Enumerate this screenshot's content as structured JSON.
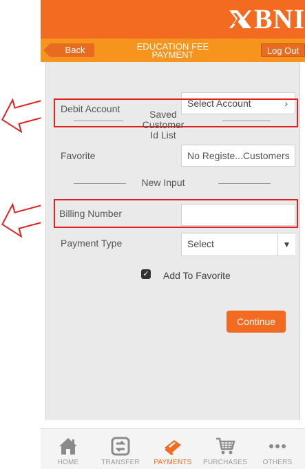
{
  "brand": {
    "logo_text": "BNI",
    "color_primary": "#f26b21",
    "color_secondary": "#f7941e",
    "highlight_color": "#e02020"
  },
  "header": {
    "back_label": "Back",
    "title_line1": "EDUCATION FEE",
    "title_line2": "PAYMENT",
    "logout_label": "Log Out"
  },
  "form": {
    "debit_account_label": "Debit Account",
    "debit_account_value": "Select Account",
    "saved_list_title_line1": "Saved Customer",
    "saved_list_title_line2": "Id List",
    "favorite_label": "Favorite",
    "favorite_value": "No Registe...Customers",
    "new_input_title": "New Input",
    "billing_number_label": "Billing Number",
    "billing_number_value": "",
    "payment_type_label": "Payment Type",
    "payment_type_value": "Select",
    "add_favorite_label": "Add To Favorite",
    "add_favorite_checked": true,
    "continue_label": "Continue"
  },
  "tabs": [
    {
      "label": "HOME",
      "icon": "home-icon",
      "active": false
    },
    {
      "label": "TRANSFER",
      "icon": "transfer-icon",
      "active": false
    },
    {
      "label": "PAYMENTS",
      "icon": "payments-icon",
      "active": true
    },
    {
      "label": "PURCHASES",
      "icon": "cart-icon",
      "active": false
    },
    {
      "label": "OTHERS",
      "icon": "more-icon",
      "active": false
    }
  ]
}
